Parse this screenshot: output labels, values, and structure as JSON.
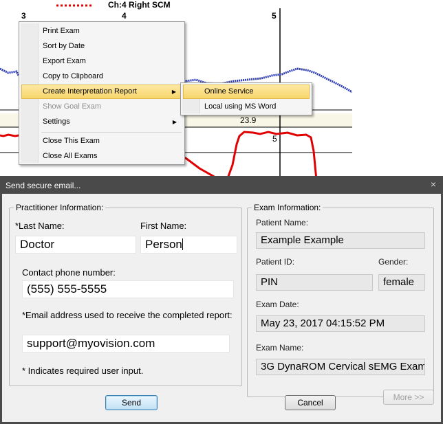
{
  "chart": {
    "title": "Ch:4 Right SCM",
    "x_ticks": [
      "3",
      "4",
      "5"
    ],
    "marker_label": "5",
    "value_label": "23.9"
  },
  "context_menu": {
    "items": [
      {
        "label": "Print Exam"
      },
      {
        "label": "Sort by Date"
      },
      {
        "label": "Export Exam"
      },
      {
        "label": "Copy to Clipboard"
      },
      {
        "label": "Create Interpretation Report"
      },
      {
        "label": "Show Goal Exam"
      },
      {
        "label": "Settings"
      },
      {
        "label": "Close This Exam"
      },
      {
        "label": "Close All Exams"
      }
    ],
    "submenu": [
      {
        "label": "Online Service"
      },
      {
        "label": "Local using MS Word"
      }
    ]
  },
  "dialog": {
    "title": "Send secure email...",
    "close_glyph": "×",
    "practitioner": {
      "legend": "Practitioner Information:",
      "last_name_label": "*Last Name:",
      "last_name_value": "Doctor",
      "first_name_label": "First Name:",
      "first_name_value": "Person",
      "phone_label": "Contact phone number:",
      "phone_value": "(555) 555-5555",
      "email_label": "*Email address used to receive the completed report:",
      "email_value": "support@myovision.com",
      "required_note": "* Indicates required user input."
    },
    "exam": {
      "legend": "Exam Information:",
      "patient_name_label": "Patient Name:",
      "patient_name_value": "Example Example",
      "patient_id_label": "Patient ID:",
      "patient_id_value": "PIN",
      "gender_label": "Gender:",
      "gender_value": "female",
      "exam_date_label": "Exam Date:",
      "exam_date_value": "May 23, 2017 04:15:52 PM",
      "exam_name_label": "Exam Name:",
      "exam_name_value": "3G DynaROM Cervical sEMG Exam"
    },
    "buttons": {
      "send": "Send",
      "cancel": "Cancel",
      "more": "More >>"
    }
  }
}
